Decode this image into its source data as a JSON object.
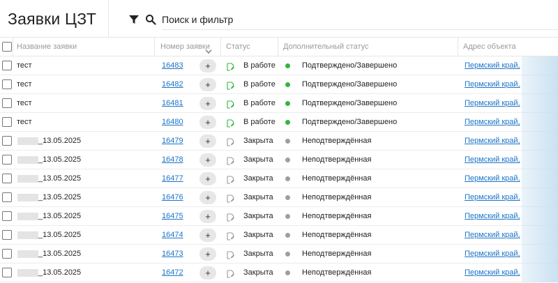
{
  "header": {
    "title": "Заявки ЦЗТ",
    "search_placeholder": "Поиск и фильтр"
  },
  "columns": {
    "name": "Название заявки",
    "number": "Номер заявки",
    "status": "Статус",
    "additional_status": "Дополнительный статус",
    "address": "Адрес объекта"
  },
  "plus_label": "+",
  "rows": [
    {
      "name": "тест",
      "number": "16483",
      "status": "В работе",
      "add_status": "Подтверждено/Завершено",
      "address": "Пермский край,",
      "dot": "green",
      "name_blurred": false
    },
    {
      "name": "тест",
      "number": "16482",
      "status": "В работе",
      "add_status": "Подтверждено/Завершено",
      "address": "Пермский край,",
      "dot": "green",
      "name_blurred": false
    },
    {
      "name": "тест",
      "number": "16481",
      "status": "В работе",
      "add_status": "Подтверждено/Завершено",
      "address": "Пермский край,",
      "dot": "green",
      "name_blurred": false
    },
    {
      "name": "тест",
      "number": "16480",
      "status": "В работе",
      "add_status": "Подтверждено/Завершено",
      "address": "Пермский край,",
      "dot": "green",
      "name_blurred": false
    },
    {
      "name": "_13.05.2025",
      "number": "16479",
      "status": "Закрыта",
      "add_status": "Неподтверждённая",
      "address": "Пермский край,",
      "dot": "gray",
      "name_blurred": true
    },
    {
      "name": "_13.05.2025",
      "number": "16478",
      "status": "Закрыта",
      "add_status": "Неподтверждённая",
      "address": "Пермский край,",
      "dot": "gray",
      "name_blurred": true
    },
    {
      "name": "_13.05.2025",
      "number": "16477",
      "status": "Закрыта",
      "add_status": "Неподтверждённая",
      "address": "Пермский край,",
      "dot": "gray",
      "name_blurred": true
    },
    {
      "name": "_13.05.2025",
      "number": "16476",
      "status": "Закрыта",
      "add_status": "Неподтверждённая",
      "address": "Пермский край,",
      "dot": "gray",
      "name_blurred": true
    },
    {
      "name": "_13.05.2025",
      "number": "16475",
      "status": "Закрыта",
      "add_status": "Неподтверждённая",
      "address": "Пермский край,",
      "dot": "gray",
      "name_blurred": true
    },
    {
      "name": "_13.05.2025",
      "number": "16474",
      "status": "Закрыта",
      "add_status": "Неподтверждённая",
      "address": "Пермский край,",
      "dot": "gray",
      "name_blurred": true
    },
    {
      "name": "_13.05.2025",
      "number": "16473",
      "status": "Закрыта",
      "add_status": "Неподтверждённая",
      "address": "Пермский край,",
      "dot": "gray",
      "name_blurred": true
    },
    {
      "name": "_13.05.2025",
      "number": "16472",
      "status": "Закрыта",
      "add_status": "Неподтверждённая",
      "address": "Пермский край,",
      "dot": "gray",
      "name_blurred": true
    }
  ],
  "colors": {
    "accent_link": "#1a73c9",
    "status_green": "#34b53a",
    "status_gray": "#9e9e9e"
  },
  "icons": {
    "filter": "filter-icon",
    "search": "search-icon",
    "sort": "chevron-down-icon",
    "status": "document-edit-icon"
  }
}
